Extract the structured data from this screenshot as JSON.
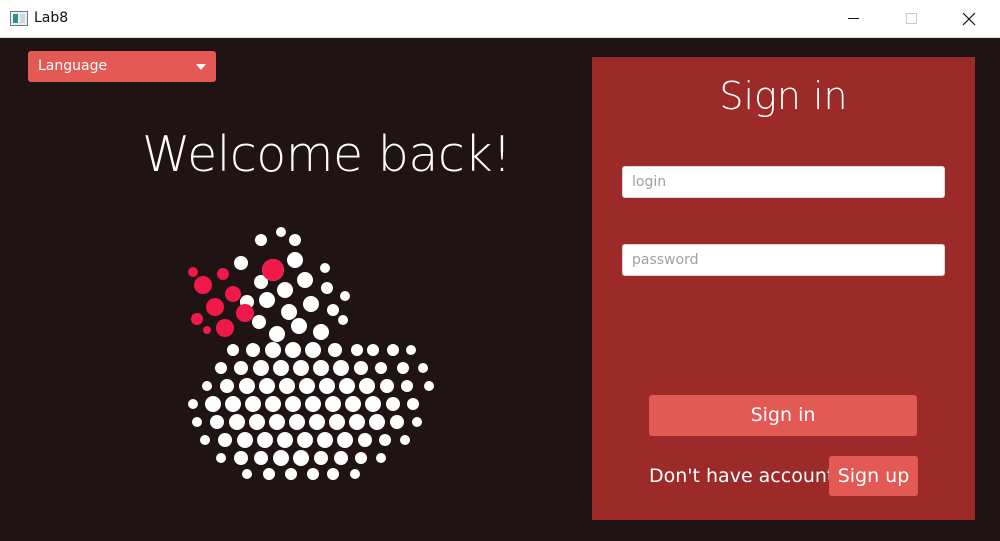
{
  "window": {
    "title": "Lab8",
    "icon": "app-window-icon",
    "controls": [
      "minimize-icon",
      "maximize-icon",
      "close-icon"
    ],
    "close_glyph": "✕"
  },
  "language_select": {
    "selected": "Language",
    "icon": "chevron-down-icon"
  },
  "welcome": {
    "heading": "Welcome back!"
  },
  "logo": {
    "name": "duck-dots-logo",
    "colors": {
      "dots": "#ffffff",
      "accent": "#f0194a"
    }
  },
  "signin_panel": {
    "title": "Sign in",
    "login_placeholder": "login",
    "password_placeholder": "password",
    "signin_label": "Sign in",
    "no_account_text": "Don't have account?",
    "signup_label": "Sign up"
  },
  "colors": {
    "background": "#1f1313",
    "panel": "#9b2a29",
    "button": "#e35a55",
    "titlebar": "#ffffff"
  }
}
